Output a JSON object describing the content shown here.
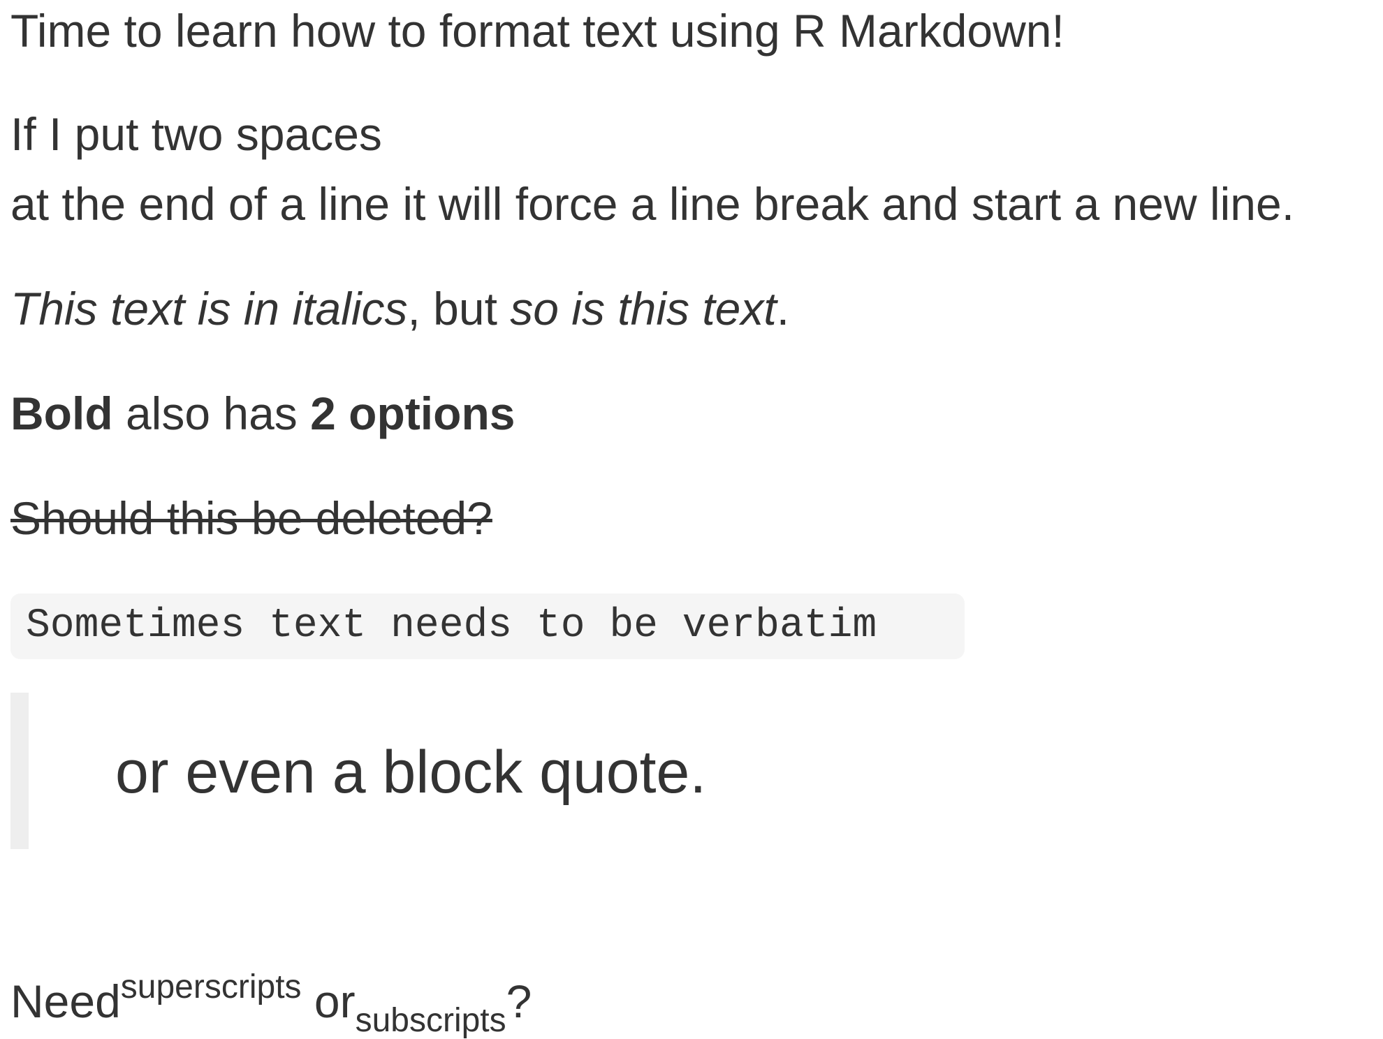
{
  "paragraphs": {
    "intro": "Time to learn how to format text using R Markdown!",
    "line_break_1": "If I put two spaces",
    "line_break_2": "at the end of a line it will force a line break and start a new line.",
    "italics_1": "This text is in italics",
    "italics_sep": ", but ",
    "italics_2": "so is this text",
    "italics_end": ".",
    "bold_1": "Bold",
    "bold_mid": " also has ",
    "bold_2": "2 options",
    "strikethrough": "Should this be deleted?",
    "verbatim": "Sometimes text needs to be verbatim",
    "blockquote": "or even a block quote.",
    "script_need": "Need",
    "script_sup": "superscripts",
    "script_or": " or",
    "script_sub": "subscripts",
    "script_end": "?"
  },
  "colors": {
    "text": "#333333",
    "code_background": "#f5f5f5",
    "blockquote_border": "#eeeeee"
  }
}
